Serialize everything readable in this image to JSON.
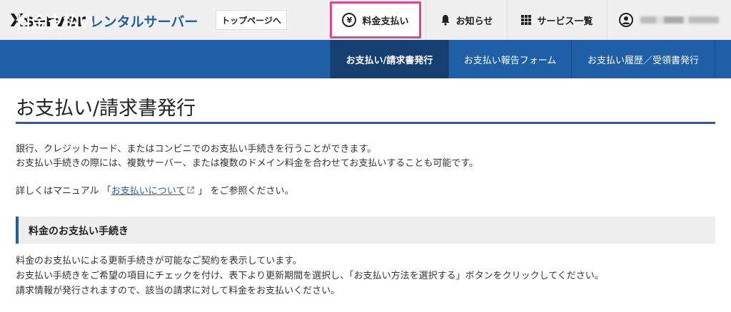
{
  "header": {
    "logo_main": "Xserver",
    "logo_sub": "レンタルサーバー",
    "toppage_label": "トップページへ",
    "nav": {
      "payment": "料金支払い",
      "notice": "お知らせ",
      "services": "サービス一覧"
    }
  },
  "titlebar": {
    "heading": "料金支払い",
    "tabs": [
      {
        "label": "お支払い/請求書発行",
        "active": true
      },
      {
        "label": "お支払い報告フォーム",
        "active": false
      },
      {
        "label": "お支払い履歴／受領書発行",
        "active": false
      }
    ]
  },
  "main": {
    "title": "お支払い/請求書発行",
    "intro_1": "銀行、クレジットカード、またはコンビニでのお支払い手続きを行うことができます。",
    "intro_2": "お支払い手続きの際には、複数サーバー、または複数のドメイン料金を合わせてお支払いすることも可能です。",
    "manual_prefix": "詳しくはマニュアル 「",
    "manual_link": "お支払いについて",
    "manual_suffix": "」 をご参照ください。",
    "section_heading": "料金のお支払い手続き",
    "section_text_1": "料金のお支払いによる更新手続きが可能なご契約を表示しています。",
    "section_text_2": "お支払い手続きをご希望の項目にチェックを付け、表下より更新期間を選択し、「お支払い方法を選択する」ボタンをクリックしてください。",
    "section_text_3": "請求情報が発行されますので、該当の請求に対して料金をお支払いください。"
  },
  "colors": {
    "brand_blue": "#1f5fa6",
    "active_tab": "#153f70",
    "highlight_pink": "#e0468c"
  },
  "icons": {
    "payment": "yen-circle-icon",
    "notice": "bell-icon",
    "services": "grid-icon",
    "account": "user-circle-icon",
    "link": "external-link-icon"
  }
}
